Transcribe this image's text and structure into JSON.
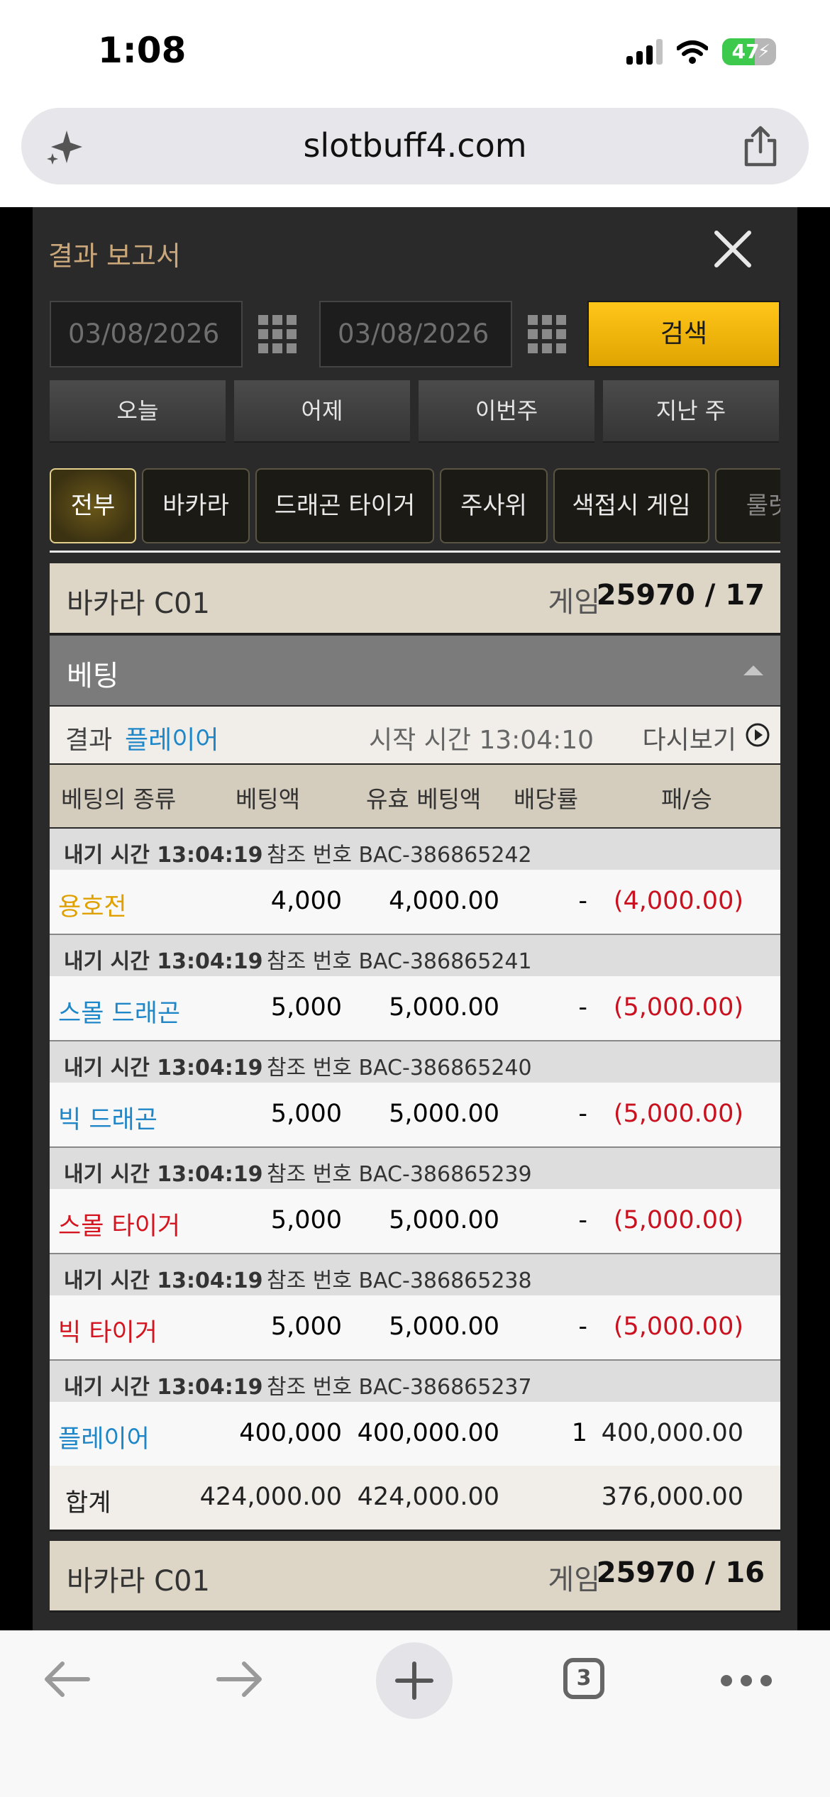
{
  "status": {
    "time": "1:08",
    "battery": "47"
  },
  "browser": {
    "url": "slotbuff4.com",
    "tab_count": "3"
  },
  "report": {
    "title": "결과 보고서",
    "date_from": "03/08/2026",
    "date_to": "03/08/2026",
    "search_label": "검색",
    "quick": [
      "오늘",
      "어제",
      "이번주",
      "지난 주"
    ],
    "tabs": [
      "전부",
      "바카라",
      "드래곤 타이거",
      "주사위",
      "색접시 게임",
      "룰렛"
    ],
    "game": {
      "name": "바카라 C01",
      "label": "게임",
      "number": "25970 / 17"
    },
    "betting_label": "베팅",
    "result": {
      "label": "결과",
      "value": "플레이어",
      "start": "시작 시간 13:04:10",
      "replay": "다시보기"
    },
    "columns": [
      "베팅의 종류",
      "베팅액",
      "유효 베팅액",
      "배당률",
      "패/승"
    ],
    "bets": [
      {
        "time": "내기 시간 13:04:19",
        "ref": "참조 번호 BAC-386865242",
        "type": "용호전",
        "type_color": "#e0a000",
        "amount": "4,000",
        "valid": "4,000.00",
        "odds": "-",
        "result": "(4,000.00)",
        "neg": true
      },
      {
        "time": "내기 시간 13:04:19",
        "ref": "참조 번호 BAC-386865241",
        "type": "스몰 드래곤",
        "type_color": "#1f86c8",
        "amount": "5,000",
        "valid": "5,000.00",
        "odds": "-",
        "result": "(5,000.00)",
        "neg": true
      },
      {
        "time": "내기 시간 13:04:19",
        "ref": "참조 번호 BAC-386865240",
        "type": "빅 드래곤",
        "type_color": "#1f86c8",
        "amount": "5,000",
        "valid": "5,000.00",
        "odds": "-",
        "result": "(5,000.00)",
        "neg": true
      },
      {
        "time": "내기 시간 13:04:19",
        "ref": "참조 번호 BAC-386865239",
        "type": "스몰 타이거",
        "type_color": "#d4141e",
        "amount": "5,000",
        "valid": "5,000.00",
        "odds": "-",
        "result": "(5,000.00)",
        "neg": true
      },
      {
        "time": "내기 시간 13:04:19",
        "ref": "참조 번호 BAC-386865238",
        "type": "빅 타이거",
        "type_color": "#d4141e",
        "amount": "5,000",
        "valid": "5,000.00",
        "odds": "-",
        "result": "(5,000.00)",
        "neg": true
      },
      {
        "time": "내기 시간 13:04:19",
        "ref": "참조 번호 BAC-386865237",
        "type": "플레이어",
        "type_color": "#1f86c8",
        "amount": "400,000",
        "valid": "400,000.00",
        "odds": "1",
        "result": "400,000.00",
        "neg": false
      }
    ],
    "total": {
      "label": "합계",
      "amount": "424,000.00",
      "valid": "424,000.00",
      "result": "376,000.00"
    },
    "game2": {
      "name": "바카라 C01",
      "label": "게임",
      "number": "25970 / 16"
    }
  }
}
